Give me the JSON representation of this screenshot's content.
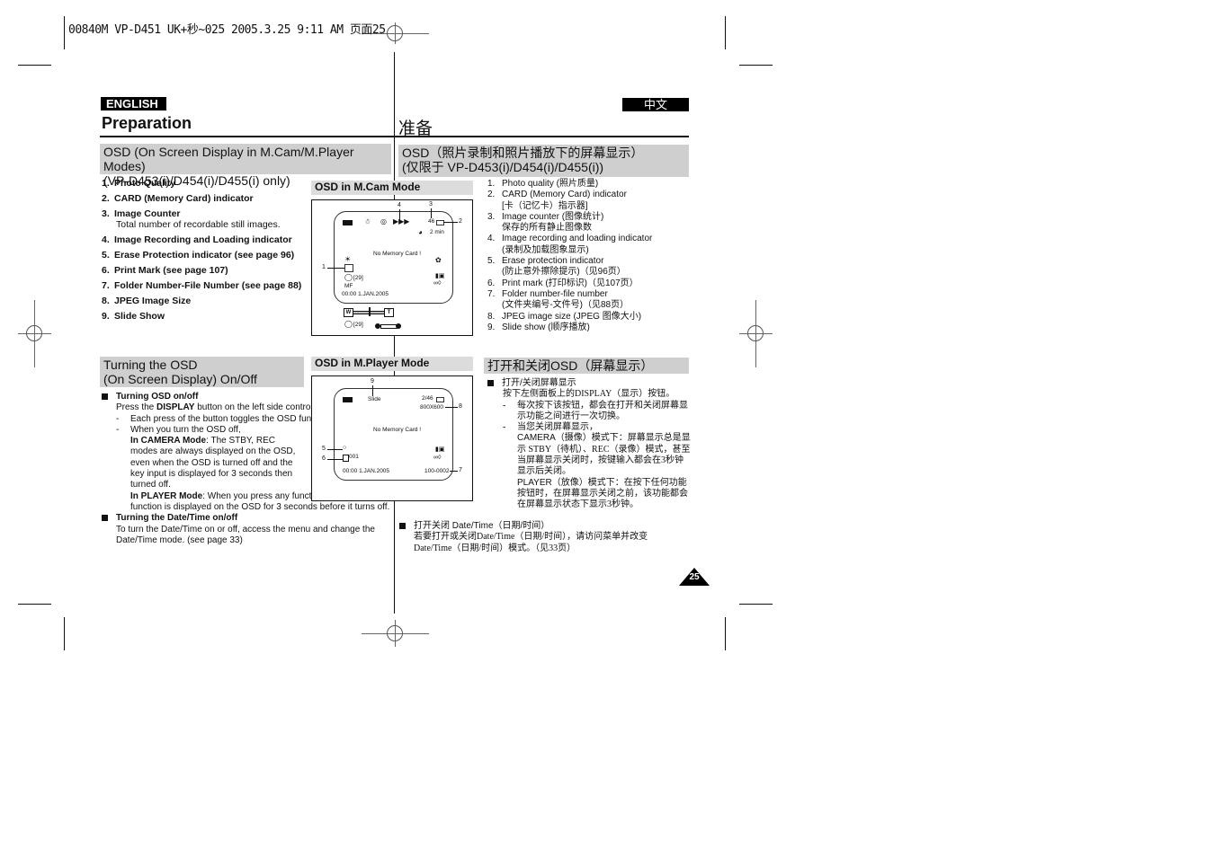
{
  "print_header": "00840M VP-D451 UK+秒~025  2005.3.25 9:11 AM 页面25",
  "left": {
    "language_badge": "ENGLISH",
    "page_title": "Preparation",
    "section1": {
      "title_line1": "OSD (On Screen Display in M.Cam/M.Player Modes)",
      "title_line2": "(VP-D453(i)/D454(i)/D455(i) only)",
      "items": [
        {
          "num": "1.",
          "label": "Photo Quality"
        },
        {
          "num": "2.",
          "label": "CARD (Memory Card) indicator"
        },
        {
          "num": "3.",
          "label": "Image Counter",
          "sub": "Total number of recordable still images."
        },
        {
          "num": "4.",
          "label": "Image Recording and Loading indicator"
        },
        {
          "num": "5.",
          "label": "Erase Protection indicator (see page 96)"
        },
        {
          "num": "6.",
          "label": "Print Mark (see page 107)"
        },
        {
          "num": "7.",
          "label": "Folder Number-File Number (see page 88)"
        },
        {
          "num": "8.",
          "label": "JPEG Image Size"
        },
        {
          "num": "9.",
          "label": "Slide Show"
        }
      ]
    },
    "section2": {
      "title_line1": "Turning the OSD",
      "title_line2": "(On Screen Display) On/Off",
      "bullet1_title": "Turning OSD on/off",
      "bullet1_text_pre": "Press the ",
      "bullet1_text_bold": "DISPLAY",
      "bullet1_text_post": " button on the left side control panel.",
      "dash1": "Each press of the button toggles the OSD function on and off.",
      "dash2": "When you turn the OSD off,",
      "camera_mode_label": "In CAMERA Mode",
      "camera_mode_text": ": The STBY, REC modes are always displayed on the OSD, even when the OSD is turned off and the key input is displayed for 3 seconds then turned off.",
      "player_mode_label": "In PLAYER Mode",
      "player_mode_text": ": When you press any function button, the function is displayed on the OSD for 3 seconds before it turns off.",
      "bullet2_title": "Turning the Date/Time on/off",
      "bullet2_text": "To turn the Date/Time on or off, access the menu and change the Date/Time mode. (see page 33)"
    }
  },
  "middle": {
    "mcam": {
      "title": "OSD in M.Cam Mode",
      "callouts": [
        "1",
        "2",
        "3",
        "4"
      ],
      "lcd": {
        "counter": "46",
        "time_left": "2 min",
        "message": "No Memory Card !",
        "self_timer": "[29]",
        "focus": "MF",
        "datetime": "00:00 1.JAN.2005",
        "zoom_w": "W",
        "zoom_t": "T",
        "bottom_timer": "[29]"
      }
    },
    "mplayer": {
      "title": "OSD in M.Player Mode",
      "callouts": [
        "5",
        "6",
        "7",
        "8",
        "9"
      ],
      "lcd": {
        "slide": "Slide",
        "counter": "2/46",
        "size": "800X600",
        "message": "No Memory Card !",
        "print_count": "001",
        "datetime": "00:00 1.JAN.2005",
        "folder_file": "100-0002"
      }
    }
  },
  "right": {
    "language_badge": "中文",
    "page_title": "准备",
    "section1": {
      "title_line1": "OSD（照片录制和照片播放下的屏幕显示）",
      "title_line2": "(仅限于 VP-D453(i)/D454(i)/D455(i))",
      "items": [
        {
          "num": "1.",
          "label": "Photo quality (照片质量)"
        },
        {
          "num": "2.",
          "label": "CARD (Memory Card) indicator",
          "sub": "[卡（记忆卡）指示器]"
        },
        {
          "num": "3.",
          "label": "Image counter (图像统计)",
          "sub": "保存的所有静止图像数"
        },
        {
          "num": "4.",
          "label": "Image recording and loading indicator",
          "sub": "(录制及加载图象显示)"
        },
        {
          "num": "5.",
          "label": "Erase protection indicator",
          "sub": "(防止意外擦除提示)（见96页）"
        },
        {
          "num": "6.",
          "label": "Print mark (打印标识)（见107页）"
        },
        {
          "num": "7.",
          "label": "Folder number-file number",
          "sub": "(文件夹编号-文件号)（见88页）"
        },
        {
          "num": "8.",
          "label": "JPEG image size (JPEG 图像大小)"
        },
        {
          "num": "9.",
          "label": "Slide show (顺序播放)"
        }
      ]
    },
    "section2": {
      "title": "打开和关闭OSD（屏幕显示）",
      "bullet1_title": "打开/关闭屏幕显示",
      "bullet1_text": "按下左侧面板上的DISPLAY（显示）按钮。",
      "dash1": "每次按下该按钮，都会在打开和关闭屏幕显示功能之间进行一次切换。",
      "dash2": "当您关闭屏幕显示，",
      "camera_label": "CAMERA（摄像）模式下：",
      "camera_text": "屏幕显示总是显示 STBY（待机）、REC（录像）模式，甚至当屏幕显示关闭时，按键输入都会在3秒钟显示后关闭。",
      "player_label": "PLAYER（放像）模式下：",
      "player_text": "在按下任何功能按钮时，在屏幕显示关闭之前，该功能都会在屏幕显示状态下显示3秒钟。",
      "bullet2_title": "打开关闭 Date/Time（日期/时间）",
      "bullet2_text": "若要打开或关闭Date/Time（日期/时间），请访问菜单并改变Date/Time（日期/时间）模式。（见33页）"
    }
  },
  "page_number": "25"
}
